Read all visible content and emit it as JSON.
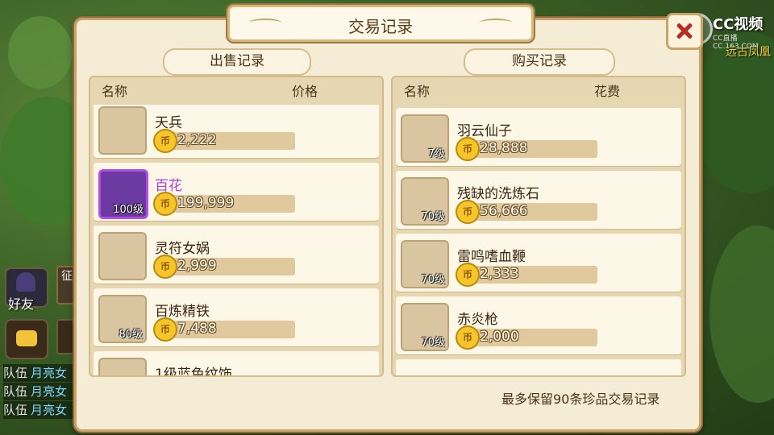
{
  "title": "交易记录",
  "watermark": {
    "brand": "CC视频",
    "sub": "CC直播  CC.163.COM",
    "overlay_text": "远古凤凰"
  },
  "left_ui": {
    "friend_label": "好友",
    "expedition_label": "征",
    "chat": [
      {
        "tag": "队伍",
        "who": "月亮女"
      },
      {
        "tag": "队伍",
        "who": "月亮女"
      },
      {
        "tag": "队伍",
        "who": "月亮女"
      }
    ]
  },
  "sell": {
    "section_title": "出售记录",
    "col_name": "名称",
    "col_price": "价格",
    "items": [
      {
        "name": "天兵",
        "price": "2,222",
        "level": "",
        "icon": "soldier-icon"
      },
      {
        "name": "百花",
        "price": "199,999",
        "level": "100级",
        "icon": "flower-icon",
        "highlight_color": "#b33cd8"
      },
      {
        "name": "灵符女娲",
        "price": "2,999",
        "level": "",
        "icon": "nuwa-icon"
      },
      {
        "name": "百炼精铁",
        "price": "7,488",
        "level": "80级",
        "icon": "iron-ore-icon"
      },
      {
        "name": "1级蓝色纹饰",
        "price": "",
        "level": "",
        "icon": "jade-ornament-icon"
      }
    ]
  },
  "buy": {
    "section_title": "购买记录",
    "col_name": "名称",
    "col_cost": "花费",
    "items": [
      {
        "name": "羽云仙子",
        "price": "28,888",
        "level": "7级",
        "icon": "fairy-icon"
      },
      {
        "name": "残缺的洗炼石",
        "price": "56,666",
        "level": "70级",
        "icon": "crystal-stone-icon"
      },
      {
        "name": "雷鸣嗜血鞭",
        "price": "2,333",
        "level": "70级",
        "icon": "whip-icon"
      },
      {
        "name": "赤炎枪",
        "price": "2,000",
        "level": "70级",
        "icon": "spear-icon"
      }
    ]
  },
  "footer_note": "最多保留90条珍品交易记录",
  "colors": {
    "accent_gold": "#c9a468",
    "panel_bg": "#f5ecd5",
    "close_red": "#b62d25",
    "rare_purple": "#b33cd8"
  }
}
